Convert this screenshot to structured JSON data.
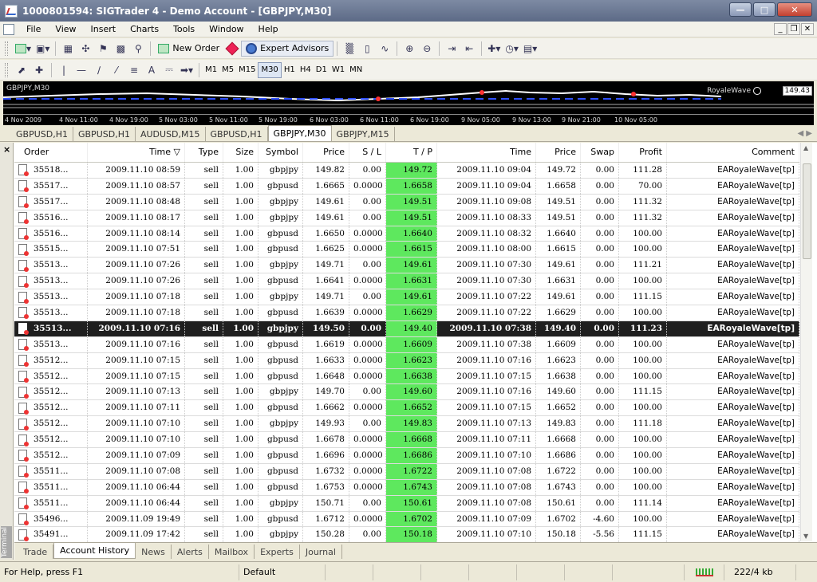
{
  "window": {
    "title": "1000801594: SIGTrader 4 - Demo Account - [GBPJPY,M30]"
  },
  "menu": [
    "File",
    "View",
    "Insert",
    "Charts",
    "Tools",
    "Window",
    "Help"
  ],
  "toolbar": {
    "new_order": "New Order",
    "expert_advisors": "Expert Advisors"
  },
  "timeframes": [
    "M1",
    "M5",
    "M15",
    "M30",
    "H1",
    "H4",
    "D1",
    "W1",
    "MN"
  ],
  "active_timeframe": "M30",
  "chart": {
    "label": "GBPJPY,M30",
    "ea_name": "RoyaleWave",
    "price": "149.43",
    "time_labels": [
      "4 Nov 2009",
      "4 Nov 11:00",
      "4 Nov 19:00",
      "5 Nov 03:00",
      "5 Nov 11:00",
      "5 Nov 19:00",
      "6 Nov 03:00",
      "6 Nov 11:00",
      "6 Nov 19:00",
      "9 Nov 05:00",
      "9 Nov 13:00",
      "9 Nov 21:00",
      "10 Nov 05:00"
    ]
  },
  "chart_tabs": [
    "GBPUSD,H1",
    "GBPUSD,H1",
    "AUDUSD,M15",
    "GBPUSD,H1",
    "GBPJPY,M30",
    "GBPJPY,M15"
  ],
  "active_chart_tab": 4,
  "table": {
    "headers": [
      "Order",
      "Time ▽",
      "Type",
      "Size",
      "Symbol",
      "Price",
      "S / L",
      "T / P",
      "Time",
      "Price",
      "Swap",
      "Profit",
      "Comment"
    ],
    "selected_row": 10,
    "rows": [
      [
        "35518...",
        "2009.11.10 08:59",
        "sell",
        "1.00",
        "gbpjpy",
        "149.82",
        "0.00",
        "149.72",
        "2009.11.10 09:04",
        "149.72",
        "0.00",
        "111.28",
        "EARoyaleWave[tp]"
      ],
      [
        "35517...",
        "2009.11.10 08:57",
        "sell",
        "1.00",
        "gbpusd",
        "1.6665",
        "0.0000",
        "1.6658",
        "2009.11.10 09:04",
        "1.6658",
        "0.00",
        "70.00",
        "EARoyaleWave[tp]"
      ],
      [
        "35517...",
        "2009.11.10 08:48",
        "sell",
        "1.00",
        "gbpjpy",
        "149.61",
        "0.00",
        "149.51",
        "2009.11.10 09:08",
        "149.51",
        "0.00",
        "111.32",
        "EARoyaleWave[tp]"
      ],
      [
        "35516...",
        "2009.11.10 08:17",
        "sell",
        "1.00",
        "gbpjpy",
        "149.61",
        "0.00",
        "149.51",
        "2009.11.10 08:33",
        "149.51",
        "0.00",
        "111.32",
        "EARoyaleWave[tp]"
      ],
      [
        "35516...",
        "2009.11.10 08:14",
        "sell",
        "1.00",
        "gbpusd",
        "1.6650",
        "0.0000",
        "1.6640",
        "2009.11.10 08:32",
        "1.6640",
        "0.00",
        "100.00",
        "EARoyaleWave[tp]"
      ],
      [
        "35515...",
        "2009.11.10 07:51",
        "sell",
        "1.00",
        "gbpusd",
        "1.6625",
        "0.0000",
        "1.6615",
        "2009.11.10 08:00",
        "1.6615",
        "0.00",
        "100.00",
        "EARoyaleWave[tp]"
      ],
      [
        "35513...",
        "2009.11.10 07:26",
        "sell",
        "1.00",
        "gbpjpy",
        "149.71",
        "0.00",
        "149.61",
        "2009.11.10 07:30",
        "149.61",
        "0.00",
        "111.21",
        "EARoyaleWave[tp]"
      ],
      [
        "35513...",
        "2009.11.10 07:26",
        "sell",
        "1.00",
        "gbpusd",
        "1.6641",
        "0.0000",
        "1.6631",
        "2009.11.10 07:30",
        "1.6631",
        "0.00",
        "100.00",
        "EARoyaleWave[tp]"
      ],
      [
        "35513...",
        "2009.11.10 07:18",
        "sell",
        "1.00",
        "gbpjpy",
        "149.71",
        "0.00",
        "149.61",
        "2009.11.10 07:22",
        "149.61",
        "0.00",
        "111.15",
        "EARoyaleWave[tp]"
      ],
      [
        "35513...",
        "2009.11.10 07:18",
        "sell",
        "1.00",
        "gbpusd",
        "1.6639",
        "0.0000",
        "1.6629",
        "2009.11.10 07:22",
        "1.6629",
        "0.00",
        "100.00",
        "EARoyaleWave[tp]"
      ],
      [
        "35513...",
        "2009.11.10 07:16",
        "sell",
        "1.00",
        "gbpjpy",
        "149.50",
        "0.00",
        "149.40",
        "2009.11.10 07:38",
        "149.40",
        "0.00",
        "111.23",
        "EARoyaleWave[tp]"
      ],
      [
        "35513...",
        "2009.11.10 07:16",
        "sell",
        "1.00",
        "gbpusd",
        "1.6619",
        "0.0000",
        "1.6609",
        "2009.11.10 07:38",
        "1.6609",
        "0.00",
        "100.00",
        "EARoyaleWave[tp]"
      ],
      [
        "35512...",
        "2009.11.10 07:15",
        "sell",
        "1.00",
        "gbpusd",
        "1.6633",
        "0.0000",
        "1.6623",
        "2009.11.10 07:16",
        "1.6623",
        "0.00",
        "100.00",
        "EARoyaleWave[tp]"
      ],
      [
        "35512...",
        "2009.11.10 07:15",
        "sell",
        "1.00",
        "gbpusd",
        "1.6648",
        "0.0000",
        "1.6638",
        "2009.11.10 07:15",
        "1.6638",
        "0.00",
        "100.00",
        "EARoyaleWave[tp]"
      ],
      [
        "35512...",
        "2009.11.10 07:13",
        "sell",
        "1.00",
        "gbpjpy",
        "149.70",
        "0.00",
        "149.60",
        "2009.11.10 07:16",
        "149.60",
        "0.00",
        "111.15",
        "EARoyaleWave[tp]"
      ],
      [
        "35512...",
        "2009.11.10 07:11",
        "sell",
        "1.00",
        "gbpusd",
        "1.6662",
        "0.0000",
        "1.6652",
        "2009.11.10 07:15",
        "1.6652",
        "0.00",
        "100.00",
        "EARoyaleWave[tp]"
      ],
      [
        "35512...",
        "2009.11.10 07:10",
        "sell",
        "1.00",
        "gbpjpy",
        "149.93",
        "0.00",
        "149.83",
        "2009.11.10 07:13",
        "149.83",
        "0.00",
        "111.18",
        "EARoyaleWave[tp]"
      ],
      [
        "35512...",
        "2009.11.10 07:10",
        "sell",
        "1.00",
        "gbpusd",
        "1.6678",
        "0.0000",
        "1.6668",
        "2009.11.10 07:11",
        "1.6668",
        "0.00",
        "100.00",
        "EARoyaleWave[tp]"
      ],
      [
        "35512...",
        "2009.11.10 07:09",
        "sell",
        "1.00",
        "gbpusd",
        "1.6696",
        "0.0000",
        "1.6686",
        "2009.11.10 07:10",
        "1.6686",
        "0.00",
        "100.00",
        "EARoyaleWave[tp]"
      ],
      [
        "35511...",
        "2009.11.10 07:08",
        "sell",
        "1.00",
        "gbpusd",
        "1.6732",
        "0.0000",
        "1.6722",
        "2009.11.10 07:08",
        "1.6722",
        "0.00",
        "100.00",
        "EARoyaleWave[tp]"
      ],
      [
        "35511...",
        "2009.11.10 06:44",
        "sell",
        "1.00",
        "gbpusd",
        "1.6753",
        "0.0000",
        "1.6743",
        "2009.11.10 07:08",
        "1.6743",
        "0.00",
        "100.00",
        "EARoyaleWave[tp]"
      ],
      [
        "35511...",
        "2009.11.10 06:44",
        "sell",
        "1.00",
        "gbpjpy",
        "150.71",
        "0.00",
        "150.61",
        "2009.11.10 07:08",
        "150.61",
        "0.00",
        "111.14",
        "EARoyaleWave[tp]"
      ],
      [
        "35496...",
        "2009.11.09 19:49",
        "sell",
        "1.00",
        "gbpusd",
        "1.6712",
        "0.0000",
        "1.6702",
        "2009.11.10 07:09",
        "1.6702",
        "-4.60",
        "100.00",
        "EARoyaleWave[tp]"
      ],
      [
        "35491...",
        "2009.11.09 17:42",
        "sell",
        "1.00",
        "gbpjpy",
        "150.28",
        "0.00",
        "150.18",
        "2009.11.10 07:10",
        "150.18",
        "-5.56",
        "111.15",
        "EARoyaleWave[tp]"
      ]
    ]
  },
  "terminal": {
    "side_label": "Terminal",
    "tabs": [
      "Trade",
      "Account History",
      "News",
      "Alerts",
      "Mailbox",
      "Experts",
      "Journal"
    ],
    "active_tab": 1
  },
  "status": {
    "help": "For Help, press F1",
    "profile": "Default",
    "traffic": "222/4 kb"
  }
}
